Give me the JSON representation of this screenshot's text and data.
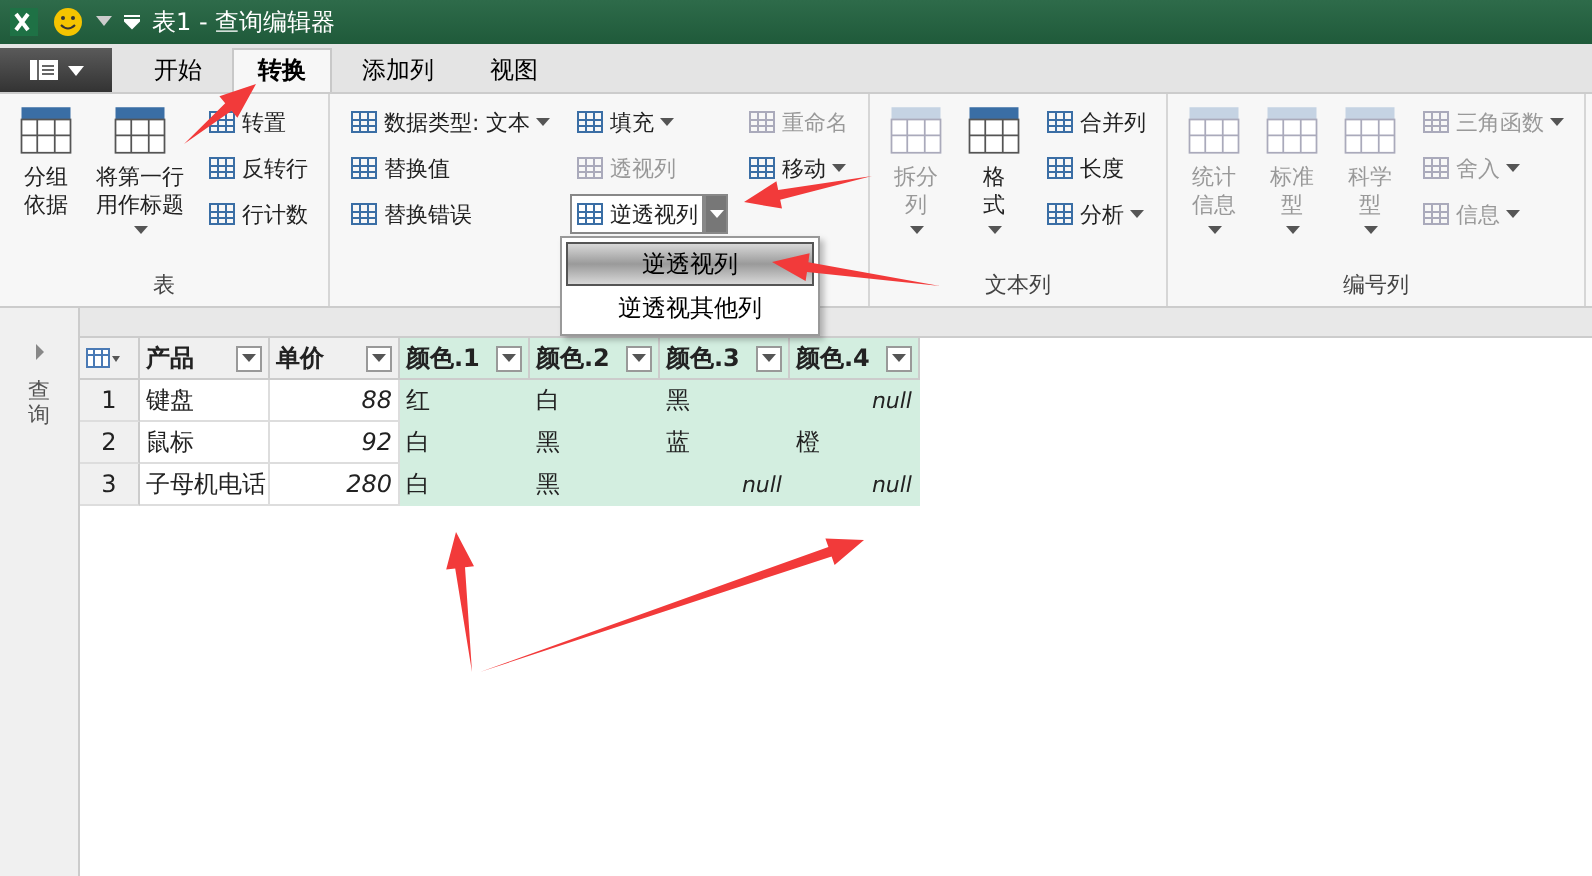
{
  "title_bar": {
    "title": "表1 - 查询编辑器"
  },
  "tabs": [
    {
      "label": "开始",
      "selected": false
    },
    {
      "label": "转换",
      "selected": true
    },
    {
      "label": "添加列",
      "selected": false
    },
    {
      "label": "视图",
      "selected": false
    }
  ],
  "ribbon": {
    "groups": [
      {
        "label": "表",
        "buttons": [
          {
            "label": "分组依据",
            "kind": "large",
            "disabled": false
          },
          {
            "label": "将第一行用作标题",
            "kind": "large",
            "disabled": false,
            "dropdown": true
          },
          {
            "label": "转置",
            "kind": "small",
            "disabled": false
          },
          {
            "label": "反转行",
            "kind": "small",
            "disabled": false
          },
          {
            "label": "行计数",
            "kind": "small",
            "disabled": false
          }
        ]
      },
      {
        "buttons": [
          {
            "label": "数据类型: 文本",
            "kind": "small",
            "disabled": false,
            "dropdown": true
          },
          {
            "label": "替换值",
            "kind": "small",
            "disabled": false
          },
          {
            "label": "替换错误",
            "kind": "small",
            "disabled": false
          },
          {
            "label": "填充",
            "kind": "small",
            "disabled": false,
            "dropdown": true
          },
          {
            "label": "透视列",
            "kind": "small",
            "disabled": true
          },
          {
            "label": "逆透视列",
            "kind": "small",
            "disabled": false,
            "split": true,
            "open": true,
            "menu": [
              {
                "label": "逆透视列",
                "selected": true
              },
              {
                "label": "逆透视其他列",
                "selected": false
              }
            ]
          },
          {
            "label": "重命名",
            "kind": "small",
            "disabled": true
          },
          {
            "label": "移动",
            "kind": "small",
            "disabled": false,
            "dropdown": true
          }
        ]
      },
      {
        "label": "文本列",
        "buttons": [
          {
            "label": "拆分列",
            "kind": "large",
            "disabled": true,
            "dropdown": true
          },
          {
            "label": "格式",
            "kind": "large",
            "disabled": false,
            "dropdown": true
          },
          {
            "label": "合并列",
            "kind": "small",
            "disabled": false
          },
          {
            "label": "长度",
            "kind": "small",
            "disabled": false
          },
          {
            "label": "分析",
            "kind": "small",
            "disabled": false,
            "dropdown": true
          }
        ]
      },
      {
        "label": "编号列",
        "buttons": [
          {
            "label": "统计信息",
            "kind": "large",
            "disabled": true,
            "dropdown": true
          },
          {
            "label": "标准型",
            "kind": "large",
            "disabled": true,
            "dropdown": true
          },
          {
            "label": "科学型",
            "kind": "large",
            "disabled": true,
            "dropdown": true
          },
          {
            "label": "三角函数",
            "kind": "small",
            "disabled": true,
            "dropdown": true
          },
          {
            "label": "舍入",
            "kind": "small",
            "disabled": true,
            "dropdown": true
          },
          {
            "label": "信息",
            "kind": "small",
            "disabled": true,
            "dropdown": true
          }
        ]
      }
    ]
  },
  "queries_pane": {
    "label": "查询"
  },
  "table": {
    "columns": [
      {
        "label": "产品",
        "highlighted": false
      },
      {
        "label": "单价",
        "highlighted": false
      },
      {
        "label": "颜色.1",
        "highlighted": true
      },
      {
        "label": "颜色.2",
        "highlighted": true
      },
      {
        "label": "颜色.3",
        "highlighted": true
      },
      {
        "label": "颜色.4",
        "highlighted": true
      }
    ],
    "rows": [
      {
        "number": "1",
        "cells": [
          {
            "text": "键盘",
            "kind": "text"
          },
          {
            "text": "88",
            "kind": "number"
          },
          {
            "text": "红",
            "kind": "text"
          },
          {
            "text": "白",
            "kind": "text"
          },
          {
            "text": "黑",
            "kind": "text"
          },
          {
            "text": "null",
            "kind": "null"
          }
        ]
      },
      {
        "number": "2",
        "cells": [
          {
            "text": "鼠标",
            "kind": "text"
          },
          {
            "text": "92",
            "kind": "number"
          },
          {
            "text": "白",
            "kind": "text"
          },
          {
            "text": "黑",
            "kind": "text"
          },
          {
            "text": "蓝",
            "kind": "text"
          },
          {
            "text": "橙",
            "kind": "text"
          }
        ]
      },
      {
        "number": "3",
        "cells": [
          {
            "text": "子母机电话",
            "kind": "text"
          },
          {
            "text": "280",
            "kind": "number"
          },
          {
            "text": "白",
            "kind": "text"
          },
          {
            "text": "黑",
            "kind": "text"
          },
          {
            "text": "null",
            "kind": "null"
          },
          {
            "text": "null",
            "kind": "null"
          }
        ]
      }
    ]
  }
}
